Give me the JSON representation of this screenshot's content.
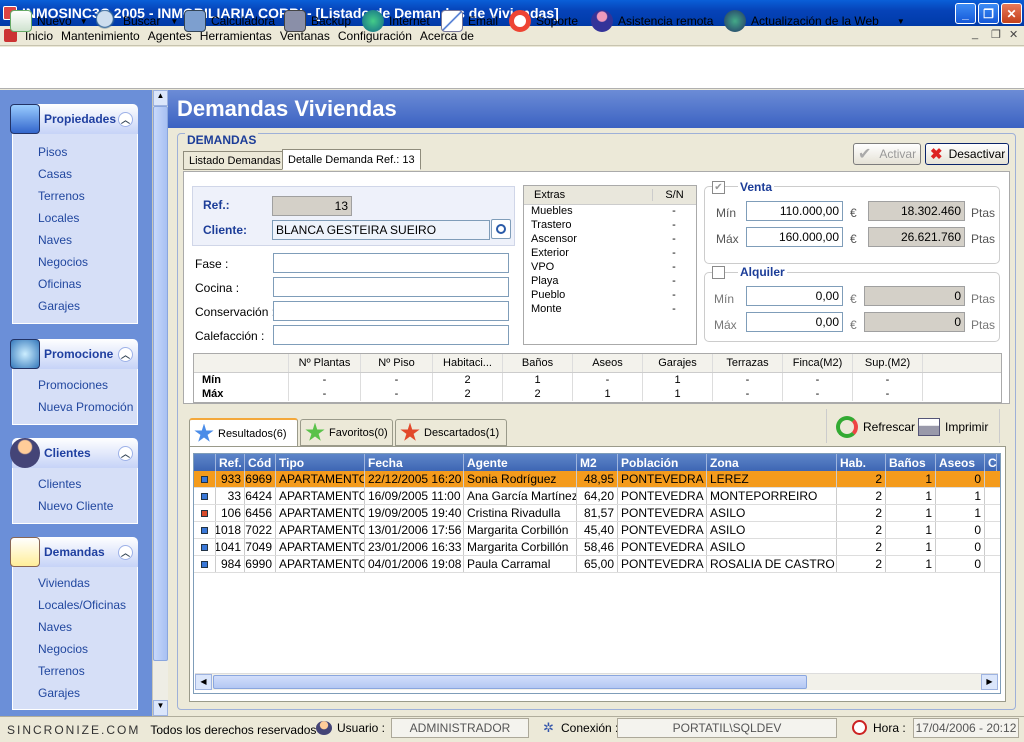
{
  "window": {
    "title": "INMOSINC3C 2005   -   INMOBILIARIA CORBI - [Listado de Demandas de Viviendas]"
  },
  "menu": [
    "Inicio",
    "Mantenimiento",
    "Agentes",
    "Herramientas",
    "Ventanas",
    "Configuración",
    "Acerca de"
  ],
  "toolbar": {
    "nuevo": "Nuevo",
    "buscar": "Buscar",
    "calculadora": "Calculadora",
    "backup": "Backup",
    "internet": "Internet",
    "email": "Email",
    "soporte": "Soporte",
    "asistencia": "Asistencia remota",
    "actualizacion": "Actualización de la Web"
  },
  "sidebar": {
    "propiedades": {
      "title": "Propiedades",
      "items": [
        "Pisos",
        "Casas",
        "Terrenos",
        "Locales",
        "Naves",
        "Negocios",
        "Oficinas",
        "Garajes"
      ]
    },
    "promociones": {
      "title": "Promocione",
      "items": [
        "Promociones",
        "Nueva Promoción"
      ]
    },
    "clientes": {
      "title": "Clientes",
      "items": [
        "Clientes",
        "Nuevo Cliente"
      ]
    },
    "demandas": {
      "title": "Demandas",
      "items": [
        "Viviendas",
        "Locales/Oficinas",
        "Naves",
        "Negocios",
        "Terrenos",
        "Garajes"
      ]
    }
  },
  "page": {
    "title": "Demandas Viviendas",
    "section": "DEMANDAS",
    "tab1": "Listado Demandas",
    "tab2": "Detalle Demanda Ref.: 13",
    "activar": "Activar",
    "desactivar": "Desactivar"
  },
  "form": {
    "ref_label": "Ref.:",
    "ref_value": "13",
    "cliente_label": "Cliente:",
    "cliente_value": "BLANCA GESTEIRA SUEIRO",
    "fase": "Fase :",
    "cocina": "Cocina :",
    "conservacion": "Conservación :",
    "calefaccion": "Calefacción :"
  },
  "extras": {
    "h1": "Extras",
    "h2": "S/N",
    "rows": [
      [
        "Muebles",
        "-"
      ],
      [
        "Trastero",
        "-"
      ],
      [
        "Ascensor",
        "-"
      ],
      [
        "Exterior",
        "-"
      ],
      [
        "VPO",
        "-"
      ],
      [
        "Playa",
        "-"
      ],
      [
        "Pueblo",
        "-"
      ],
      [
        "Monte",
        "-"
      ]
    ]
  },
  "venta": {
    "title": "Venta",
    "min_label": "Mín",
    "max_label": "Máx",
    "min": "110.000,00",
    "max": "160.000,00",
    "eur": "€",
    "min_ptas": "18.302.460",
    "max_ptas": "26.621.760",
    "ptas": "Ptas"
  },
  "alquiler": {
    "title": "Alquiler",
    "min_label": "Mín",
    "max_label": "Máx",
    "min": "0,00",
    "max": "0,00",
    "eur": "€",
    "min_ptas": "0",
    "max_ptas": "0",
    "ptas": "Ptas"
  },
  "specs": {
    "headers": [
      "",
      "Nº Plantas",
      "Nº Piso",
      "Habitaci...",
      "Baños",
      "Aseos",
      "Garajes",
      "Terrazas",
      "Finca(M2)",
      "Sup.(M2)"
    ],
    "rows": [
      [
        "Mín",
        "-",
        "-",
        "2",
        "1",
        "-",
        "1",
        "-",
        "-",
        "-"
      ],
      [
        "Máx",
        "-",
        "-",
        "2",
        "2",
        "1",
        "1",
        "-",
        "-",
        "-"
      ]
    ]
  },
  "tabs": {
    "resultados": "Resultados(6)",
    "favoritos": "Favoritos(0)",
    "descartados": "Descartados(1)",
    "refrescar": "Refrescar",
    "imprimir": "Imprimir"
  },
  "results": {
    "headers": [
      "",
      "Ref.",
      "Cód",
      "Tipo",
      "Fecha",
      "Agente",
      "M2",
      "Población",
      "Zona",
      "Hab.",
      "Baños",
      "Aseos",
      "C"
    ],
    "rows": [
      [
        "933",
        "6969",
        "APARTAMENTO",
        "22/12/2005 16:20",
        "Sonia Rodríguez",
        "48,95",
        "PONTEVEDRA",
        "LEREZ",
        "2",
        "1",
        "0"
      ],
      [
        "33",
        "6424",
        "APARTAMENTO",
        "16/09/2005 11:00",
        "Ana García Martínez",
        "64,20",
        "PONTEVEDRA",
        "MONTEPORREIRO",
        "2",
        "1",
        "1"
      ],
      [
        "106",
        "6456",
        "APARTAMENTO",
        "19/09/2005 19:40",
        "Cristina Rivadulla",
        "81,57",
        "PONTEVEDRA",
        "ASILO",
        "2",
        "1",
        "1"
      ],
      [
        "1018",
        "7022",
        "APARTAMENTO",
        "13/01/2006 17:56",
        "Margarita Corbillón",
        "45,40",
        "PONTEVEDRA",
        "ASILO",
        "2",
        "1",
        "0"
      ],
      [
        "1041",
        "7049",
        "APARTAMENTO",
        "23/01/2006 16:33",
        "Margarita Corbillón",
        "58,46",
        "PONTEVEDRA",
        "ASILO",
        "2",
        "1",
        "0"
      ],
      [
        "984",
        "6990",
        "APARTAMENTO",
        "04/01/2006 19:08",
        "Paula Carramal",
        "65,00",
        "PONTEVEDRA",
        "ROSALIA DE CASTRO",
        "2",
        "1",
        "0"
      ]
    ],
    "row_marks": [
      "#3a78d8",
      "#3a78d8",
      "#d84a2a",
      "#3a78d8",
      "#3a78d8",
      "#3a78d8"
    ]
  },
  "status": {
    "brand": "SINCRONIZE.COM",
    "rights": "Todos los derechos reservados",
    "usuario_label": "Usuario :",
    "usuario": "ADMINISTRADOR",
    "conexion_label": "Conexión :",
    "conexion": "PORTATIL\\SQLDEV",
    "hora_label": "Hora :",
    "hora": "17/04/2006 - 20:12"
  }
}
